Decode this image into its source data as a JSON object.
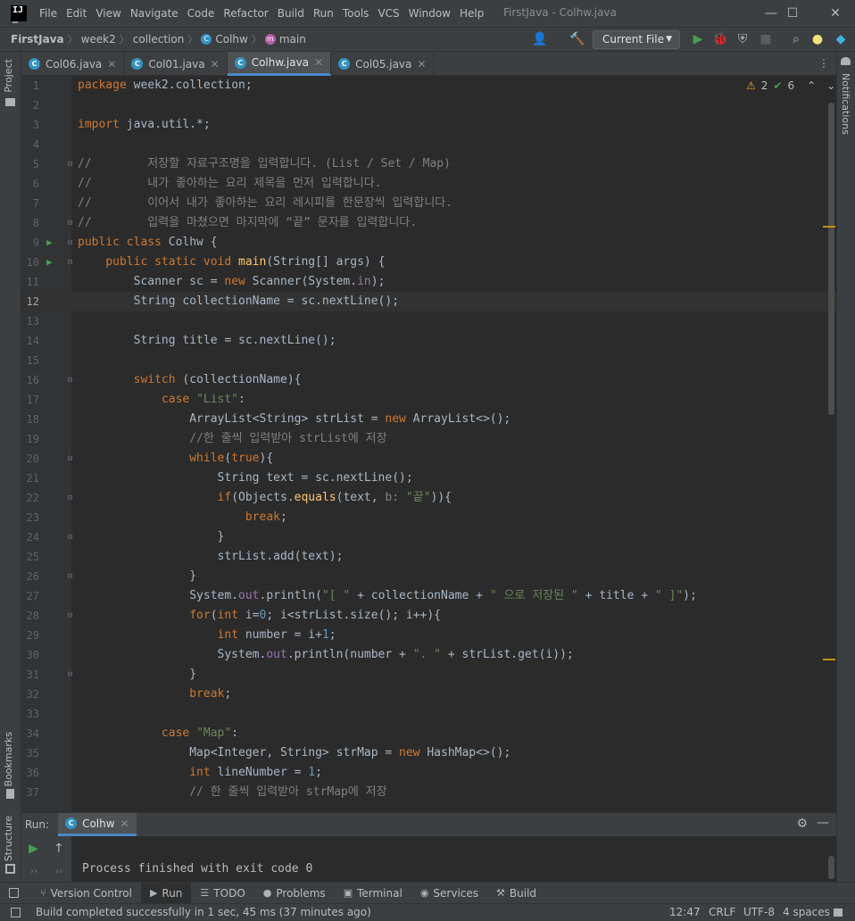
{
  "menu": {
    "items": [
      "File",
      "Edit",
      "View",
      "Navigate",
      "Code",
      "Refactor",
      "Build",
      "Run",
      "Tools",
      "VCS",
      "Window",
      "Help"
    ],
    "window_title": "FirstJava - Colhw.java"
  },
  "navbar": {
    "crumbs": [
      "FirstJava",
      "week2",
      "collection",
      "Colhw",
      "main"
    ],
    "run_config": "Current File"
  },
  "left_strip": {
    "project": "Project",
    "bookmarks": "Bookmarks",
    "structure": "Structure"
  },
  "right_strip": {
    "notifications": "Notifications"
  },
  "tabs": [
    {
      "label": "Col06.java",
      "active": false
    },
    {
      "label": "Col01.java",
      "active": false
    },
    {
      "label": "Colhw.java",
      "active": true
    },
    {
      "label": "Col05.java",
      "active": false
    }
  ],
  "inspections": {
    "warnings": "2",
    "ok": "6"
  },
  "editor": {
    "current_line": 12,
    "lines": [
      {
        "n": "1",
        "html": "<span class='kw'>package</span> week2.collection;"
      },
      {
        "n": "2",
        "html": ""
      },
      {
        "n": "3",
        "html": "<span class='kw'>import</span> java.util.*;"
      },
      {
        "n": "4",
        "html": ""
      },
      {
        "n": "5",
        "html": "<span class='cm'>//        저장할 자료구조명을 입력합니다. (List / Set / Map)</span>"
      },
      {
        "n": "6",
        "html": "<span class='cm'>//        내가 좋아하는 요리 제목을 먼저 입력합니다.</span>"
      },
      {
        "n": "7",
        "html": "<span class='cm'>//        이어서 내가 좋아하는 요리 레시피를 한문장씩 입력합니다.</span>"
      },
      {
        "n": "8",
        "html": "<span class='cm'>//        입력을 마쳤으면 마지막에 “끝” 문자를 입력합니다.</span>"
      },
      {
        "n": "9",
        "html": "<span class='kw'>public class</span> Colhw {"
      },
      {
        "n": "10",
        "html": "    <span class='kw'>public static void</span> <span class='fn'>main</span>(String[] args) {"
      },
      {
        "n": "11",
        "html": "        Scanner sc = <span class='kw'>new</span> Scanner(System.<span class='fld'>in</span>);"
      },
      {
        "n": "12",
        "html": "        String collectionName = sc.nextLine();"
      },
      {
        "n": "13",
        "html": ""
      },
      {
        "n": "14",
        "html": "        String title = sc.nextLine();"
      },
      {
        "n": "15",
        "html": ""
      },
      {
        "n": "16",
        "html": "        <span class='kw'>switch</span> (collectionName){"
      },
      {
        "n": "17",
        "html": "            <span class='kw'>case</span> <span class='str'>\"List\"</span>:"
      },
      {
        "n": "18",
        "html": "                ArrayList&lt;String&gt; strList = <span class='kw'>new</span> ArrayList&lt;&gt;();"
      },
      {
        "n": "19",
        "html": "                <span class='cm'>//한 줄씩 입력받아 strList에 저장</span>"
      },
      {
        "n": "20",
        "html": "                <span class='kw'>while</span>(<span class='kw'>true</span>){"
      },
      {
        "n": "21",
        "html": "                    String text = sc.nextLine();"
      },
      {
        "n": "22",
        "html": "                    <span class='kw'>if</span>(Objects.<span class='fn'>equals</span>(text, <span class='cm'>b:</span> <span class='str'>\"끝\"</span>)){"
      },
      {
        "n": "23",
        "html": "                        <span class='kw'>break</span>;"
      },
      {
        "n": "24",
        "html": "                    }"
      },
      {
        "n": "25",
        "html": "                    strList.add(text);"
      },
      {
        "n": "26",
        "html": "                }"
      },
      {
        "n": "27",
        "html": "                System.<span class='fld'>out</span>.println(<span class='str'>\"[ \"</span> + collectionName + <span class='str'>\" 으로 저장된 \"</span> + title + <span class='str'>\" ]\"</span>);"
      },
      {
        "n": "28",
        "html": "                <span class='kw'>for</span>(<span class='kw'>int</span> i=<span class='num'>0</span>; i&lt;strList.size(); i++){"
      },
      {
        "n": "29",
        "html": "                    <span class='kw'>int</span> number = i+<span class='num'>1</span>;"
      },
      {
        "n": "30",
        "html": "                    System.<span class='fld'>out</span>.println(number + <span class='str'>\". \"</span> + strList.get(i));"
      },
      {
        "n": "31",
        "html": "                }"
      },
      {
        "n": "32",
        "html": "                <span class='kw'>break</span>;"
      },
      {
        "n": "33",
        "html": ""
      },
      {
        "n": "34",
        "html": "            <span class='kw'>case</span> <span class='str'>\"Map\"</span>:"
      },
      {
        "n": "35",
        "html": "                Map&lt;Integer, String&gt; strMap = <span class='kw'>new</span> HashMap&lt;&gt;();"
      },
      {
        "n": "36",
        "html": "                <span class='kw'>int</span> lineNumber = <span class='num'>1</span>;"
      },
      {
        "n": "37",
        "html": "                <span class='cm'>// 한 줄씩 입력받아 strMap에 저장</span>"
      }
    ]
  },
  "run_panel": {
    "title": "Run:",
    "tab": "Colhw",
    "console": "Process finished with exit code 0"
  },
  "bottom_tools": [
    "Version Control",
    "Run",
    "TODO",
    "Problems",
    "Terminal",
    "Services",
    "Build"
  ],
  "status": {
    "message": "Build completed successfully in 1 sec, 45 ms (37 minutes ago)",
    "time": "12:47",
    "line_sep": "CRLF",
    "encoding": "UTF-8",
    "indent": "4 spaces"
  }
}
